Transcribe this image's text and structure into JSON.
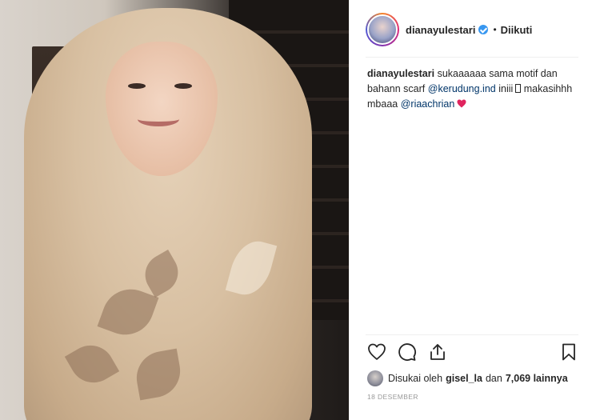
{
  "post": {
    "username": "dianayulestari",
    "follow_status": "Diikuti",
    "separator": "•"
  },
  "caption": {
    "username": "dianayulestari",
    "text_part1": "sukaaaaaa sama motif dan bahann scarf",
    "mention1": "@kerudung.ind",
    "text_part2": "iniii",
    "text_part3": "makasihhh mbaaa",
    "mention2": "@riaachrian"
  },
  "likes": {
    "prefix": "Disukai oleh",
    "user": "gisel_la",
    "connector": "dan",
    "count_text": "7,069 lainnya"
  },
  "date": "18 DESEMBER",
  "icons": {
    "like": "heart-outline-icon",
    "comment": "speech-bubble-icon",
    "share": "share-upload-icon",
    "save": "bookmark-icon",
    "verified": "verified-badge-icon",
    "caption_heart": "red-heart-icon"
  },
  "colors": {
    "mention": "#003569",
    "verified": "#3897f0",
    "heart": "#e0245e",
    "meta": "#999999"
  }
}
